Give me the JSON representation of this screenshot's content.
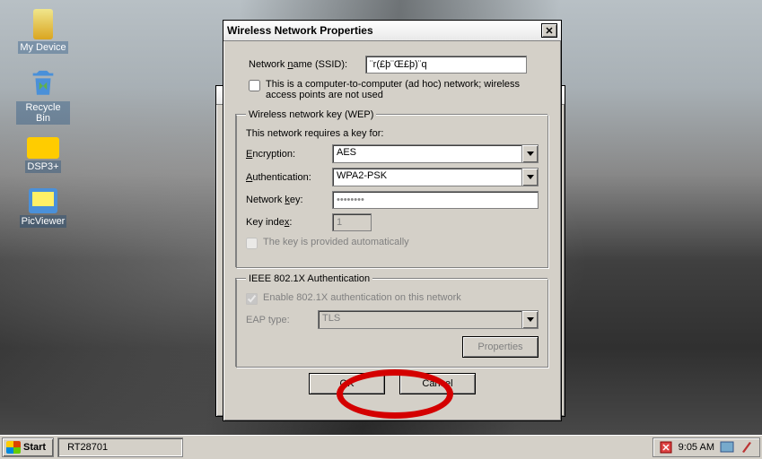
{
  "desktop": {
    "icons": [
      {
        "name": "my-device",
        "label": "My Device"
      },
      {
        "name": "recycle-bin",
        "label": "Recycle Bin"
      },
      {
        "name": "dsp3",
        "label": "DSP3+"
      },
      {
        "name": "picviewer",
        "label": "PicViewer"
      }
    ]
  },
  "dialog": {
    "title": "Wireless Network Properties",
    "ssid_label": "Network name (SSID):",
    "ssid_value": "¨r(£þ¨Œ£þ)¨q",
    "adhoc_text": "This is a computer-to-computer (ad hoc) network; wireless access points are not used",
    "adhoc_checked": false,
    "wep": {
      "legend": "Wireless network key (WEP)",
      "requires_text": "This network requires a key for:",
      "encryption_label": "Encryption:",
      "encryption_value": "AES",
      "auth_label": "Authentication:",
      "auth_value": "WPA2-PSK",
      "netkey_label": "Network key:",
      "netkey_value": "••••••••",
      "keyindex_label": "Key index:",
      "keyindex_value": "1",
      "auto_key_text": "The key is provided automatically",
      "auto_key_checked": false
    },
    "ieee": {
      "legend": "IEEE 802.1X Authentication",
      "enable_text": "Enable 802.1X authentication on this network",
      "enable_checked": true,
      "eap_label": "EAP type:",
      "eap_value": "TLS",
      "properties_btn": "Properties"
    },
    "ok_btn": "OK",
    "cancel_btn": "Cancel"
  },
  "taskbar": {
    "start_label": "Start",
    "task_label": "RT28701",
    "clock": "9:05 AM"
  }
}
